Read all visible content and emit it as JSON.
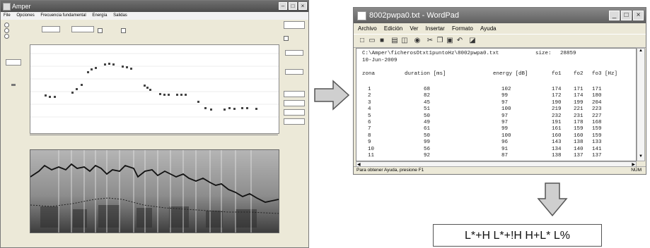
{
  "amper": {
    "title": "Amper",
    "menu": [
      "File",
      "Opciones",
      "Frecuencia fundamental",
      "Energía",
      "Salidas"
    ]
  },
  "wordpad": {
    "title": "8002pwpa0.txt - WordPad",
    "menu": [
      "Archivo",
      "Edición",
      "Ver",
      "Insertar",
      "Formato",
      "Ayuda"
    ],
    "path_line": "C:\\Amper\\ficherosOtxt1puntoHz\\8002pwpa0.txt",
    "size_label": "size:",
    "size_value": "28859",
    "date": "10-Jun-2009",
    "headers": [
      "zona",
      "duration [ms]",
      "energy [dB]",
      "fo1",
      "fo2",
      "fo3 [Hz]"
    ],
    "rows": [
      [
        "1",
        "68",
        "102",
        "174",
        "171",
        "171"
      ],
      [
        "2",
        "82",
        "99",
        "172",
        "174",
        "180"
      ],
      [
        "3",
        "45",
        "97",
        "190",
        "199",
        "204"
      ],
      [
        "4",
        "51",
        "100",
        "219",
        "221",
        "223"
      ],
      [
        "5",
        "50",
        "97",
        "232",
        "231",
        "227"
      ],
      [
        "6",
        "49",
        "97",
        "191",
        "178",
        "168"
      ],
      [
        "7",
        "61",
        "99",
        "161",
        "159",
        "159"
      ],
      [
        "8",
        "50",
        "100",
        "160",
        "160",
        "159"
      ],
      [
        "9",
        "99",
        "96",
        "143",
        "138",
        "133"
      ],
      [
        "10",
        "56",
        "91",
        "134",
        "140",
        "141"
      ],
      [
        "11",
        "92",
        "87",
        "138",
        "137",
        "137"
      ]
    ],
    "status": "Para obtener Ayuda, presione F1",
    "status_right": "NÚM"
  },
  "result": "L*+H L*+!H H+L* L%"
}
